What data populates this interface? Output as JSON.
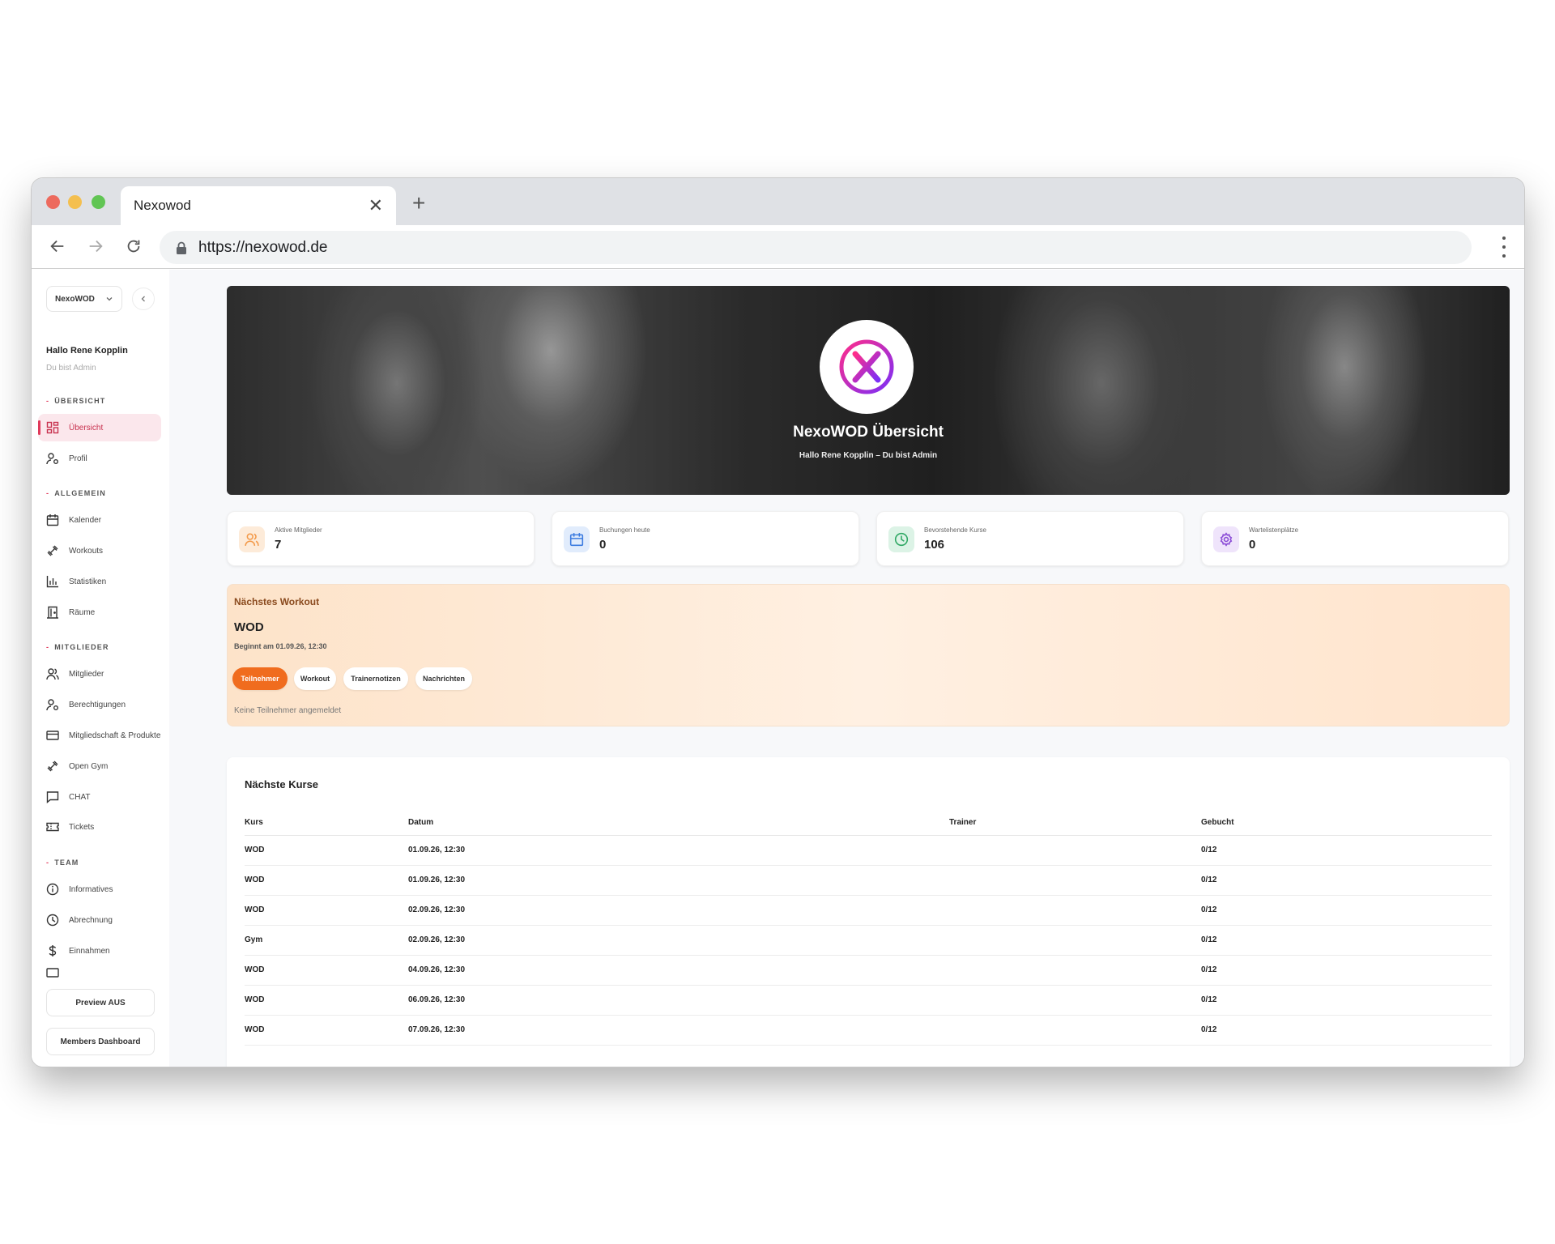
{
  "browser": {
    "tab_title": "Nexowod",
    "url": "https://nexowod.de"
  },
  "sidebar": {
    "gym_select": "NexoWOD",
    "greeting": "Hallo Rene Kopplin",
    "role": "Du bist Admin",
    "sections": {
      "uebersicht": "ÜBERSICHT",
      "allgemein": "ALLGEMEIN",
      "mitglieder": "MITGLIEDER",
      "team": "TEAM"
    },
    "items": {
      "uebersicht": "Übersicht",
      "profil": "Profil",
      "kalender": "Kalender",
      "workouts": "Workouts",
      "statistiken": "Statistiken",
      "raeume": "Räume",
      "mitglieder": "Mitglieder",
      "berechtigungen": "Berechtigungen",
      "mitgliedschaft": "Mitgliedschaft & Produkte",
      "opengym": "Open Gym",
      "chat": "CHAT",
      "tickets": "Tickets",
      "informatives": "Informatives",
      "abrechnung": "Abrechnung",
      "einnahmen": "Einnahmen"
    },
    "preview_button": "Preview AUS",
    "members_button": "Members Dashboard"
  },
  "hero": {
    "title": "NexoWOD Übersicht",
    "subtitle": "Hallo Rene Kopplin – Du bist Admin"
  },
  "stats": [
    {
      "label": "Aktive Mitglieder",
      "value": "7",
      "icon": "users-icon",
      "color": "#f39a4a"
    },
    {
      "label": "Buchungen heute",
      "value": "0",
      "icon": "calendar-icon",
      "color": "#3b7be0"
    },
    {
      "label": "Bevorstehende Kurse",
      "value": "106",
      "icon": "clock-icon",
      "color": "#2fa864"
    },
    {
      "label": "Wartelistenplätze",
      "value": "0",
      "icon": "gear-icon",
      "color": "#8a4bd6"
    }
  ],
  "next_workout": {
    "heading": "Nächstes Workout",
    "name": "WOD",
    "starts": "Beginnt am 01.09.26, 12:30",
    "tabs": [
      "Teilnehmer",
      "Workout",
      "Trainernotizen",
      "Nachrichten"
    ],
    "empty_text": "Keine Teilnehmer angemeldet"
  },
  "courses": {
    "title": "Nächste Kurse",
    "columns": [
      "Kurs",
      "Datum",
      "Trainer",
      "Gebucht"
    ],
    "rows": [
      {
        "kurs": "WOD",
        "datum": "01.09.26, 12:30",
        "trainer": "",
        "gebucht": "0/12"
      },
      {
        "kurs": "WOD",
        "datum": "01.09.26, 12:30",
        "trainer": "",
        "gebucht": "0/12"
      },
      {
        "kurs": "WOD",
        "datum": "02.09.26, 12:30",
        "trainer": "",
        "gebucht": "0/12"
      },
      {
        "kurs": "Gym",
        "datum": "02.09.26, 12:30",
        "trainer": "",
        "gebucht": "0/12"
      },
      {
        "kurs": "WOD",
        "datum": "04.09.26, 12:30",
        "trainer": "",
        "gebucht": "0/12"
      },
      {
        "kurs": "WOD",
        "datum": "06.09.26, 12:30",
        "trainer": "",
        "gebucht": "0/12"
      },
      {
        "kurs": "WOD",
        "datum": "07.09.26, 12:30",
        "trainer": "",
        "gebucht": "0/12"
      }
    ]
  },
  "colors": {
    "accent": "#e0395a",
    "orange": "#f06c1e"
  }
}
